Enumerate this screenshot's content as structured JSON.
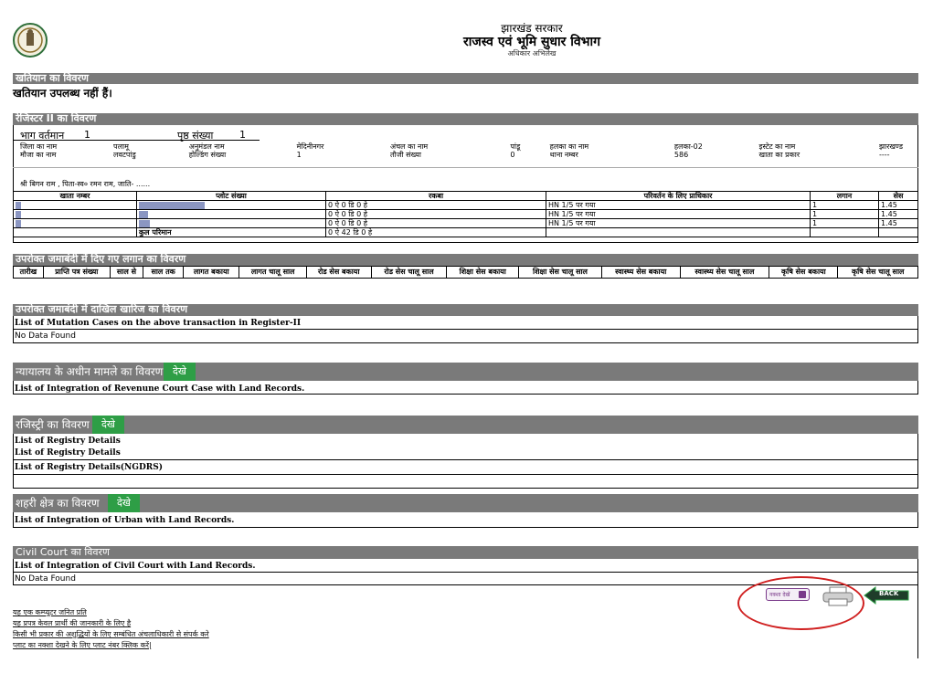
{
  "header": {
    "line1": "झारखंड सरकार",
    "line2": "राजस्व एवं भूमि सुधार विभाग",
    "line3": "अधिकार अभिलेख"
  },
  "khatiyan": {
    "title": "खतियान का विवरण",
    "message": "खतियान उपलब्ध नहीं हैं।"
  },
  "register2": {
    "title": "रेजिस्टर II का विवरण",
    "bhag_label": "भाग वर्तमान",
    "bhag_value": "1",
    "prishth_label": "पृष्ठ संख्या",
    "prishth_value": "1",
    "info_rows": [
      [
        "जिला का नाम",
        "पलामू",
        "अनुमंडल नाम",
        "मेदिनीनगर",
        "अंचल का नाम",
        "पांडू",
        "हलका का नाम",
        "हलका-02",
        "इस्टेट का नाम",
        "झारखण्ड"
      ],
      [
        "मौजा का नाम",
        "लवटपांडु",
        "होल्डिंग संख्या",
        "1",
        "तौजी संख्या",
        "0",
        "थाना नम्बर",
        "586",
        "खाता का प्रकार",
        "----"
      ]
    ],
    "owner": "श्री बिगन राम , पिता-स्व० रमन राम, जाति- ......",
    "headers": [
      "खाता नम्बर",
      "प्लोट संख्या",
      "रकबा",
      "परिवर्तन के लिए प्राधिकार",
      "लगान",
      "सेस"
    ],
    "rows": [
      {
        "rakba": "0  ऐ  0  डि 0  हे",
        "auth": "HN 1/5 पर गया",
        "lagan": "1",
        "ses": "1.45"
      },
      {
        "rakba": "0  ऐ  0  डि 0  हे",
        "auth": "HN 1/5 पर गया",
        "lagan": "1",
        "ses": "1.45"
      },
      {
        "rakba": "0  ऐ  0  डि 0  हे",
        "auth": "HN 1/5 पर गया",
        "lagan": "1",
        "ses": "1.45"
      }
    ],
    "total_label": "कुल परिमान",
    "total_value": "0  ऐ  42  डि 0  हे"
  },
  "lagan": {
    "title": "उपरोक्त जमाबंदी में दिए गए लगान का विवरण",
    "headers": [
      "तारीख",
      "प्राप्ति पत्र संख्या",
      "साल से",
      "साल तक",
      "लागत बकाया",
      "लागत चालू साल",
      "रोड सेस बकाया",
      "रोड सेस चालू साल",
      "शिक्षा सेस बकाया",
      "शिक्षा सेस चालू साल",
      "स्वास्थ्य सेस बकाया",
      "स्वास्थ्य सेस चालू साल",
      "कृषि सेस बकाया",
      "कृषि सेस चालू साल"
    ]
  },
  "mutation": {
    "title": "उपरोक्त जमाबंदी में दाखिल खारिज का विवरण",
    "subtitle": "List of Mutation Cases on the above transaction in Register-II",
    "nodata": "No Data Found"
  },
  "court": {
    "title": "न्यायालय के अधीन मामले का विवरण",
    "btn": "देखे",
    "subtitle": "List of Integration of Revenune Court Case with Land Records."
  },
  "registry": {
    "title": "रजिस्ट्री का विवरण",
    "btn": "देखे",
    "lines": [
      "List of Registry Details",
      "List of Registry Details",
      "List of Registry Details(NGDRS)"
    ]
  },
  "urban": {
    "title": "शहरी क्षेत्र का विवरण",
    "btn": "देखे",
    "subtitle": "List of Integration of Urban with Land Records."
  },
  "civil": {
    "title": "Civil Court का विवरण",
    "subtitle": "List of Integration of Civil Court with Land Records.",
    "nodata": "No Data Found"
  },
  "actions": {
    "naksha": "नक्शा देखें",
    "back": "BACK",
    "circle_color": "#d02020"
  },
  "footer_links": [
    "यह एक कम्प्यूटर जनित प्रति",
    "यह प्रपत्र केवल प्रार्थी की जानकारी के लिए है",
    "किसी भी प्रकार की अशुद्धियों के लिए सम्बंधित अंचलाधिकारी से संपर्क करे",
    "प्लाट का नक्शा देखने के लिए प्लाट नंबर क्लिक करें|"
  ]
}
